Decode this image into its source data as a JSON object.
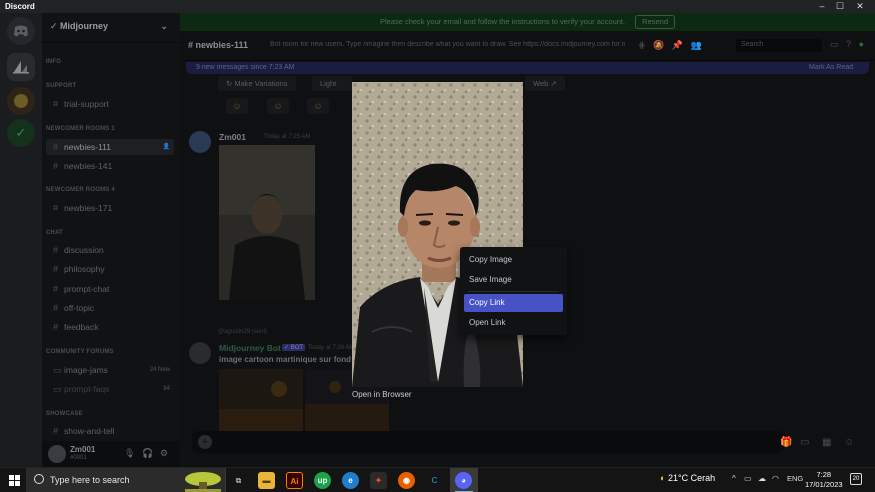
{
  "window": {
    "title": "Discord",
    "minimize": "–",
    "maximize": "☐",
    "close": "✕"
  },
  "banner": {
    "text": "Please check your email and follow the instructions to verify your account.",
    "resend": "Resend"
  },
  "server": {
    "name": "Midjourney"
  },
  "sidebar": {
    "categories": [
      "INFO",
      "SUPPORT",
      "NEWCOMER ROOMS 1",
      "NEWCOMER ROOMS 4",
      "CHAT",
      "COMMUNITY FORUMS",
      "SHOWCASE"
    ],
    "channels": [
      {
        "label": "trial-support"
      },
      {
        "label": "newbies-111",
        "active": true
      },
      {
        "label": "newbies-141"
      },
      {
        "label": "newbies-171"
      },
      {
        "label": "discussion"
      },
      {
        "label": "philosophy"
      },
      {
        "label": "prompt-chat"
      },
      {
        "label": "off-topic"
      },
      {
        "label": "feedback"
      },
      {
        "label": "image-jams",
        "badge": "24 New"
      },
      {
        "label": "prompt-faqs",
        "badge": "84"
      },
      {
        "label": "show-and-tell"
      }
    ]
  },
  "user": {
    "name": "Zm001",
    "tag": "#0001"
  },
  "header": {
    "channel": "newbies-111",
    "topic": "Bot room for new users. Type /imagine then describe what you want to draw. See https://docs.midjourney.com for more information",
    "search_placeholder": "Search"
  },
  "new_messages": {
    "text": "9 new messages since 7:23 AM",
    "mark": "Mark As Read"
  },
  "messages": {
    "make_variations": "Make Variations",
    "light": "Light",
    "web": "Web",
    "user1": {
      "name": "Zm001",
      "time": "Today at 7:25 AM"
    },
    "reply": "@agustin29 (sent)",
    "bot": {
      "name": "Midjourney Bot",
      "badge": "✓ BOT",
      "time": "Today at 7:26 AM",
      "text": "image cartoon martinique sur fond"
    }
  },
  "viewer": {
    "open_in_browser": "Open in Browser"
  },
  "context_menu": {
    "items": [
      {
        "label": "Copy Image"
      },
      {
        "label": "Save Image"
      },
      {
        "label": "Copy Link",
        "hover": true
      },
      {
        "label": "Open Link"
      }
    ]
  },
  "taskbar": {
    "search_text": "Type here to search",
    "weather": "21°C  Cerah",
    "lang": "ENG",
    "time": "7:28",
    "date": "17/01/2023",
    "notifications": "20"
  },
  "colors": {
    "accent": "#4752c4",
    "banner_green": "#0c2a12",
    "new_bar": "#1a1d3f"
  }
}
